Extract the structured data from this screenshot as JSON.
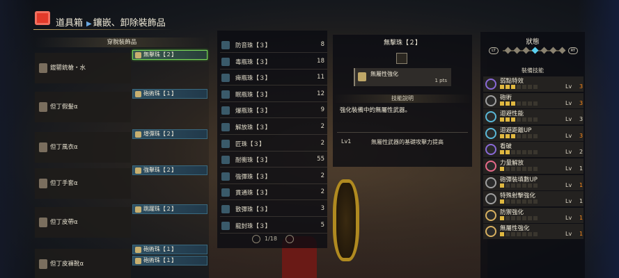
{
  "header": {
    "title_parts": [
      "道具箱",
      "鑲嵌、卸除裝飾品"
    ]
  },
  "left_panel": {
    "title": "穿脫裝飾品",
    "equipment": [
      {
        "name": "鎧罌銃槍・水",
        "slots": [
          {
            "label": "無擊珠【２】",
            "selected": true
          }
        ]
      },
      {
        "name": "但丁假髮α",
        "slots": [
          {
            "label": "砲術珠【１】"
          }
        ]
      },
      {
        "name": "但丁風衣α",
        "slots": [
          {
            "label": "增彈珠【２】"
          }
        ]
      },
      {
        "name": "但丁手套α",
        "slots": [
          {
            "label": "強擊珠【２】"
          }
        ]
      },
      {
        "name": "但丁皮帶α",
        "slots": [
          {
            "label": "跳躍珠【２】"
          }
        ]
      },
      {
        "name": "但丁皮褲靴α",
        "slots": [
          {
            "label": "砲術珠【１】"
          },
          {
            "label": "砲術珠【１】"
          }
        ]
      }
    ]
  },
  "deco_list": {
    "items": [
      {
        "name": "防音珠【３】",
        "count": "8"
      },
      {
        "name": "毒瓶珠【３】",
        "count": "18"
      },
      {
        "name": "痺瓶珠【３】",
        "count": "11"
      },
      {
        "name": "眠瓶珠【３】",
        "count": "12"
      },
      {
        "name": "爆瓶珠【３】",
        "count": "9"
      },
      {
        "name": "解放珠【３】",
        "count": "2"
      },
      {
        "name": "匠珠【３】",
        "count": "2"
      },
      {
        "name": "耐衝珠【３】",
        "count": "55"
      },
      {
        "name": "強彈珠【３】",
        "count": "2"
      },
      {
        "name": "貫通珠【３】",
        "count": "2"
      },
      {
        "name": "散彈珠【３】",
        "count": "3"
      },
      {
        "name": "龍封珠【３】",
        "count": "5"
      }
    ],
    "pager": "1/18"
  },
  "detail": {
    "title": "無擊珠【２】",
    "skill_name": "無屬性強化",
    "skill_pts": "1 pts",
    "desc_header": "技能說明",
    "desc_text": "強化裝備中的無屬性武器。",
    "level_label": "Lv1",
    "level_text": "無屬性武器的基礎攻擊力提高"
  },
  "right_panel": {
    "title": "狀態",
    "lt": "LT",
    "rt": "RT",
    "sub_title": "裝備技能",
    "active_dot": 3,
    "skills": [
      {
        "name": "弱點特效",
        "lv": "Lv",
        "val": "3",
        "max_color": "#ff8a1a",
        "filled": 3,
        "icon_color": "#8a6ad8"
      },
      {
        "name": "砲術",
        "lv": "Lv",
        "val": "3",
        "max_color": "#ff8a1a",
        "filled": 3,
        "icon_color": "#a0a0a0"
      },
      {
        "name": "迴避性能",
        "lv": "Lv",
        "val": "3",
        "max_color": "#e0dac8",
        "filled": 3,
        "icon_color": "#5ab8d8"
      },
      {
        "name": "迴避距離UP",
        "lv": "Lv",
        "val": "3",
        "max_color": "#ff8a1a",
        "filled": 3,
        "icon_color": "#5ab8d8"
      },
      {
        "name": "看破",
        "lv": "Lv",
        "val": "2",
        "max_color": "#e0dac8",
        "filled": 2,
        "icon_color": "#8a6ad8"
      },
      {
        "name": "力量解放",
        "lv": "Lv",
        "val": "1",
        "max_color": "#e0dac8",
        "filled": 1,
        "icon_color": "#e86a8a"
      },
      {
        "name": "砲彈裝填數UP",
        "lv": "Lv",
        "val": "1",
        "max_color": "#ff8a1a",
        "filled": 1,
        "icon_color": "#a0a0a0"
      },
      {
        "name": "特殊射擊強化",
        "lv": "Lv",
        "val": "1",
        "max_color": "#e0dac8",
        "filled": 1,
        "icon_color": "#a0a0a0"
      },
      {
        "name": "防禦強化",
        "lv": "Lv",
        "val": "1",
        "max_color": "#ff8a1a",
        "filled": 1,
        "icon_color": "#d8b060"
      },
      {
        "name": "無屬性強化",
        "lv": "Lv",
        "val": "1",
        "max_color": "#ff8a1a",
        "filled": 1,
        "icon_color": "#d8b060"
      }
    ]
  }
}
